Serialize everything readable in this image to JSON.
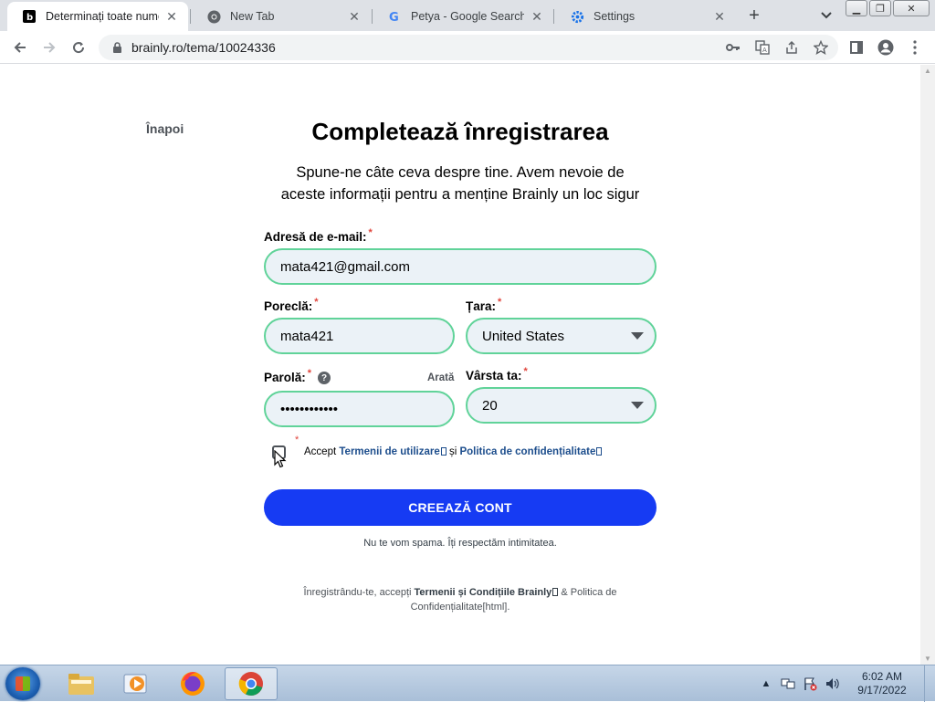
{
  "browser": {
    "tabs": [
      {
        "title": "Determinați toate numere",
        "active": true,
        "icon": "brainly-favicon"
      },
      {
        "title": "New Tab",
        "active": false,
        "icon": "chrome-icon"
      },
      {
        "title": "Petya - Google Search",
        "active": false,
        "icon": "google-icon"
      },
      {
        "title": "Settings",
        "active": false,
        "icon": "gear-icon"
      }
    ],
    "new_tab_label": "+",
    "url": "brainly.ro/tema/10024336"
  },
  "page": {
    "back_label": "Înapoi",
    "title": "Completează înregistrarea",
    "subtitle_line1": "Spune-ne câte ceva despre tine. Avem nevoie de",
    "subtitle_line2": "aceste informații pentru a menține Brainly un loc sigur",
    "email": {
      "label": "Adresă de e-mail:",
      "required": "*",
      "value": "mata421@gmail.com"
    },
    "nickname": {
      "label": "Poreclă:",
      "required": "*",
      "value": "mata421"
    },
    "country": {
      "label": "Țara:",
      "required": "*",
      "value": "United States"
    },
    "password": {
      "label": "Parolă:",
      "required": "*",
      "value": "••••••••••••",
      "show_label": "Arată",
      "help_icon": "?"
    },
    "age": {
      "label": "Vârsta ta:",
      "required": "*",
      "value": "20"
    },
    "terms": {
      "required": "*",
      "accept": "Accept",
      "terms_link": "Termenii de utilizare",
      "and": "și",
      "privacy_link": "Politica de confidențialitate",
      "checked": false
    },
    "submit_label": "CREEAZĂ CONT",
    "no_spam": "Nu te vom spama. Îți respectăm intimitatea.",
    "legal_prefix": "Înregistrându-te, accepți",
    "legal_terms": "Termenii și Condițiile Brainly",
    "legal_suffix": "& Politica de Confidențialitate[html]."
  },
  "taskbar": {
    "apps": [
      "file-explorer-icon",
      "media-player-icon",
      "firefox-icon",
      "chrome-icon"
    ],
    "time": "6:02 AM",
    "date": "9/17/2022"
  },
  "colors": {
    "accent_blue": "#163bf3",
    "field_border": "#60d399",
    "field_bg": "#ebf2f7",
    "required_red": "#e0453c"
  }
}
